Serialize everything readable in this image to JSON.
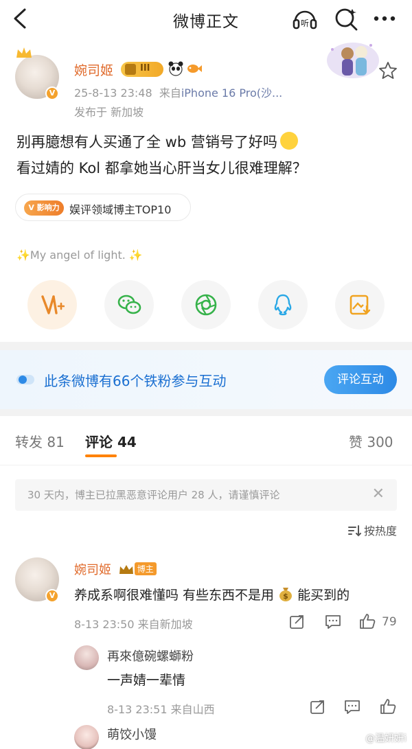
{
  "topbar": {
    "title": "微博正文"
  },
  "post": {
    "author": "婉司姬",
    "level": "III",
    "time": "25-8-13 23:48",
    "from_prefix": "来自",
    "from_device": "iPhone 16 Pro(沙...",
    "location": "发布于 新加坡",
    "text_line1": "别再臆想有人买通了全 wb 营销号了好吗",
    "text_line2": "看过婧的 Kol 都拿她当心肝当女儿很难理解？",
    "influence_tag": "V 影响力",
    "influence_text": "娱评领域博主TOP10",
    "signature": "✨My angel of light. ✨"
  },
  "fans_banner": {
    "text": "此条微博有66个铁粉参与互动",
    "button": "评论互动"
  },
  "tabs": {
    "repost": "转发 81",
    "comment": "评论 44",
    "like": "赞 300"
  },
  "notice": {
    "text": "30 天内，博主已拉黑恶意评论用户 28 人，请谨慎评论",
    "close": "✕"
  },
  "sort": {
    "label": "按热度"
  },
  "comments": [
    {
      "name": "婉司姬",
      "badge": "博主",
      "text_before": "养成系啊很难懂吗 有些东西不是用",
      "text_after": "能买到的",
      "meta": "8-13 23:50 来自新加坡",
      "likes": "79"
    },
    {
      "name": "再來億碗螺螄粉",
      "text": "一声婧一辈情",
      "meta": "8-13 23:51 来自山西"
    },
    {
      "name": "萌饺小馒"
    }
  ],
  "watermark": "@温妍妍i"
}
